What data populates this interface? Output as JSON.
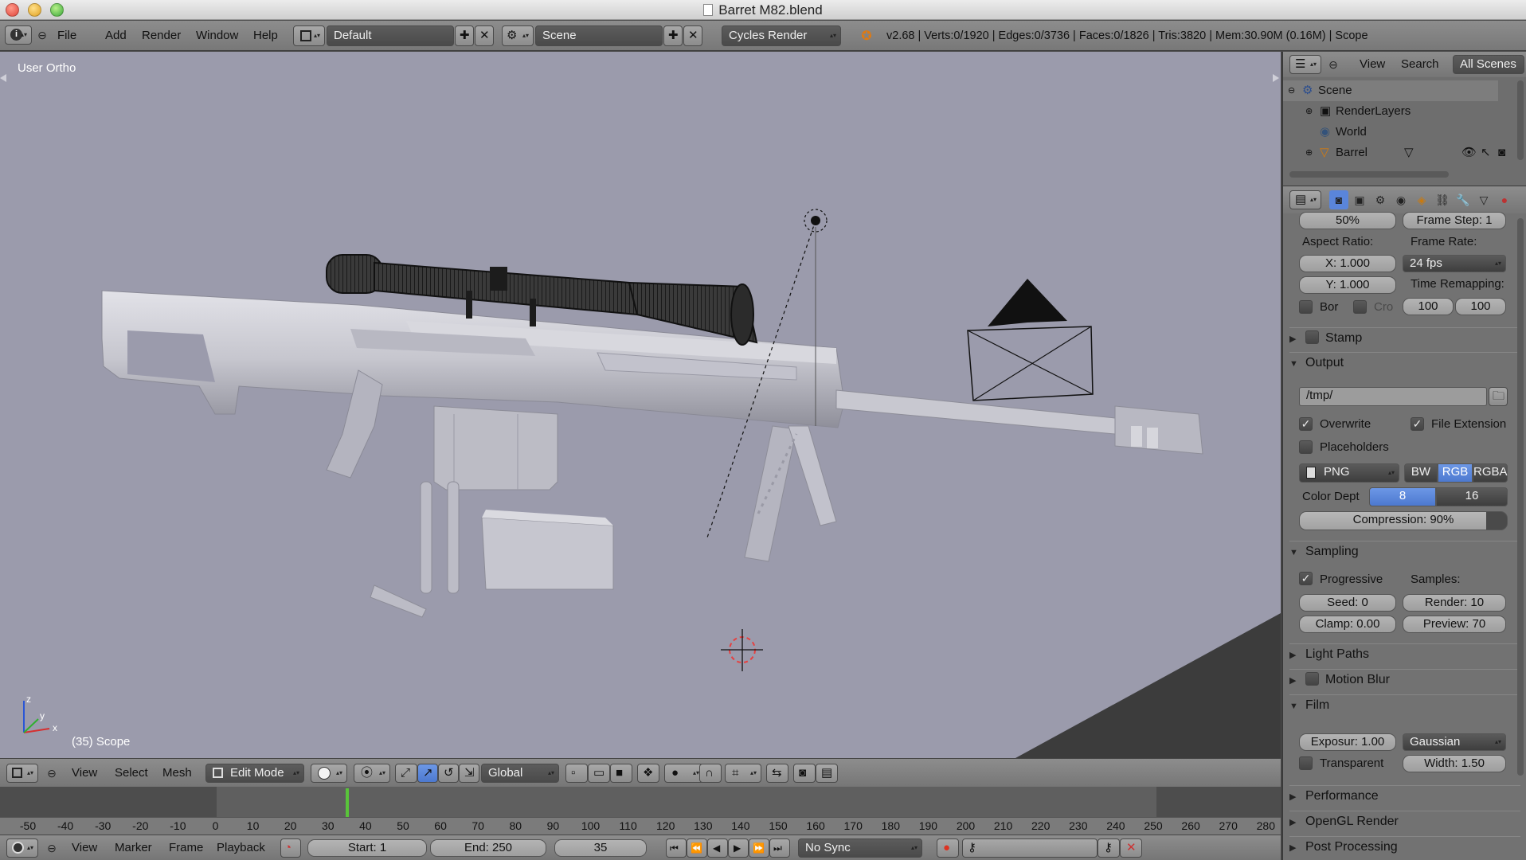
{
  "window": {
    "title": "Barret M82.blend"
  },
  "info_header": {
    "menus": [
      "File",
      "Add",
      "Render",
      "Window",
      "Help"
    ],
    "screen_layout": "Default",
    "scene": "Scene",
    "render_engine": "Cycles Render",
    "stats": "v2.68 | Verts:0/1920 | Edges:0/3736 | Faces:0/1826 | Tris:3820 | Mem:30.90M (0.16M) | Scope"
  },
  "viewport": {
    "view_label": "User Ortho",
    "object_label": "(35) Scope",
    "axes": {
      "x": "x",
      "y": "y",
      "z": "z"
    }
  },
  "viewport_header": {
    "menus": [
      "View",
      "Select",
      "Mesh"
    ],
    "mode": "Edit Mode",
    "orientation": "Global"
  },
  "timeline": {
    "ticks": [
      "-50",
      "-40",
      "-30",
      "-20",
      "-10",
      "0",
      "10",
      "20",
      "30",
      "40",
      "50",
      "60",
      "70",
      "80",
      "90",
      "100",
      "110",
      "120",
      "130",
      "140",
      "150",
      "160",
      "170",
      "180",
      "190",
      "200",
      "210",
      "220",
      "230",
      "240",
      "250",
      "260",
      "270",
      "280"
    ],
    "current_frame": 35,
    "menus": [
      "View",
      "Marker",
      "Frame",
      "Playback"
    ],
    "start": "Start: 1",
    "end": "End: 250",
    "frame": "35",
    "sync": "No Sync"
  },
  "outliner": {
    "menus": [
      "View",
      "Search"
    ],
    "filter": "All Scenes",
    "items": [
      "Scene",
      "RenderLayers",
      "World",
      "Barrel"
    ]
  },
  "properties": {
    "resolution_pct": "50%",
    "frame_step": "Frame Step: 1",
    "aspect_ratio_label": "Aspect Ratio:",
    "aspect_x": "X: 1.000",
    "aspect_y": "Y: 1.000",
    "frame_rate_label": "Frame Rate:",
    "frame_rate": "24 fps",
    "time_remapping_label": "Time Remapping:",
    "time_old": "100",
    "time_new": "100",
    "border_label": "Bor",
    "crop_label": "Cro",
    "stamp_label": "Stamp",
    "output_label": "Output",
    "output_path": "/tmp/",
    "overwrite_label": "Overwrite",
    "file_extension_label": "File Extension",
    "placeholders_label": "Placeholders",
    "file_format": "PNG",
    "color_modes": [
      "BW",
      "RGB",
      "RGBA"
    ],
    "color_depth_label": "Color Dept",
    "color_depths": [
      "8",
      "16"
    ],
    "compression": "Compression: 90%",
    "compression_value": 0.9,
    "sampling_label": "Sampling",
    "progressive_label": "Progressive",
    "samples_label": "Samples:",
    "seed": "Seed: 0",
    "render_samples": "Render: 10",
    "clamp": "Clamp: 0.00",
    "preview_samples": "Preview: 70",
    "light_paths_label": "Light Paths",
    "motion_blur_label": "Motion Blur",
    "film_label": "Film",
    "exposure": "Exposur: 1.00",
    "filter_type": "Gaussian",
    "transparent_label": "Transparent",
    "filter_width": "Width: 1.50",
    "performance_label": "Performance",
    "opengl_render_label": "OpenGL Render",
    "post_processing_label": "Post Processing"
  },
  "colors": {
    "viewport_bg": "#9b9bac",
    "header_bg": "#808080",
    "accent_blue": "#5a85da",
    "frame_cursor": "#59c43a"
  }
}
